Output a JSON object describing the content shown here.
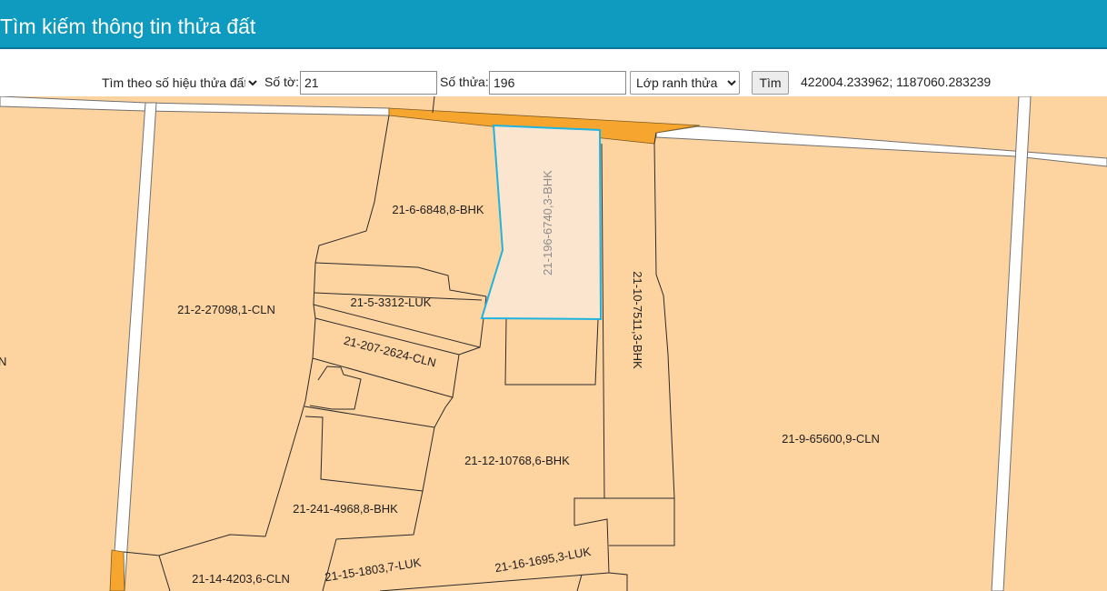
{
  "header": {
    "title": "Tìm kiếm thông tin thửa đất"
  },
  "toolbar": {
    "search_mode": {
      "selected": "Tìm theo số hiệu thửa đất",
      "options": [
        "Tìm theo số hiệu thửa đất"
      ]
    },
    "sheet_label": "Số tờ:",
    "sheet_value": "21",
    "parcel_label": "Số thửa:",
    "parcel_value": "196",
    "layer": {
      "selected": "Lớp ranh thửa",
      "options": [
        "Lớp ranh thửa"
      ]
    },
    "search_button": "Tìm",
    "coordinates": "422004.233962; 1187060.283239"
  },
  "map": {
    "colors": {
      "parcel_fill": "#fdd3a0",
      "parcel_border": "#2b2b2b",
      "road": "#ffffff",
      "road_edge": "#707070",
      "canal": "#f6a62e",
      "selected_fill": "#fbe5ce",
      "selected_border": "#1fb3e0"
    },
    "parcels": [
      {
        "id": "21-6",
        "label": "21-6-6848,8-BHK"
      },
      {
        "id": "21-196",
        "label": "21-196-6740,3-BHK",
        "selected": true
      },
      {
        "id": "21-5",
        "label": "21-5-3312-LUK"
      },
      {
        "id": "21-2",
        "label": "21-2-27098,1-CLN"
      },
      {
        "id": "21-207",
        "label": "21-207-2624-CLN"
      },
      {
        "id": "21-10",
        "label": "21-10-7511,3-BHK"
      },
      {
        "id": "21-9",
        "label": "21-9-65600,9-CLN"
      },
      {
        "id": "21-12",
        "label": "21-12-10768,6-BHK"
      },
      {
        "id": "21-241",
        "label": "21-241-4968,8-BHK"
      },
      {
        "id": "21-14",
        "label": "21-14-4203,6-CLN"
      },
      {
        "id": "21-15",
        "label": "21-15-1803,7-LUK"
      },
      {
        "id": "21-16",
        "label": "21-16-1695,3-LUK"
      },
      {
        "id": "edge",
        "label": "N"
      }
    ]
  }
}
